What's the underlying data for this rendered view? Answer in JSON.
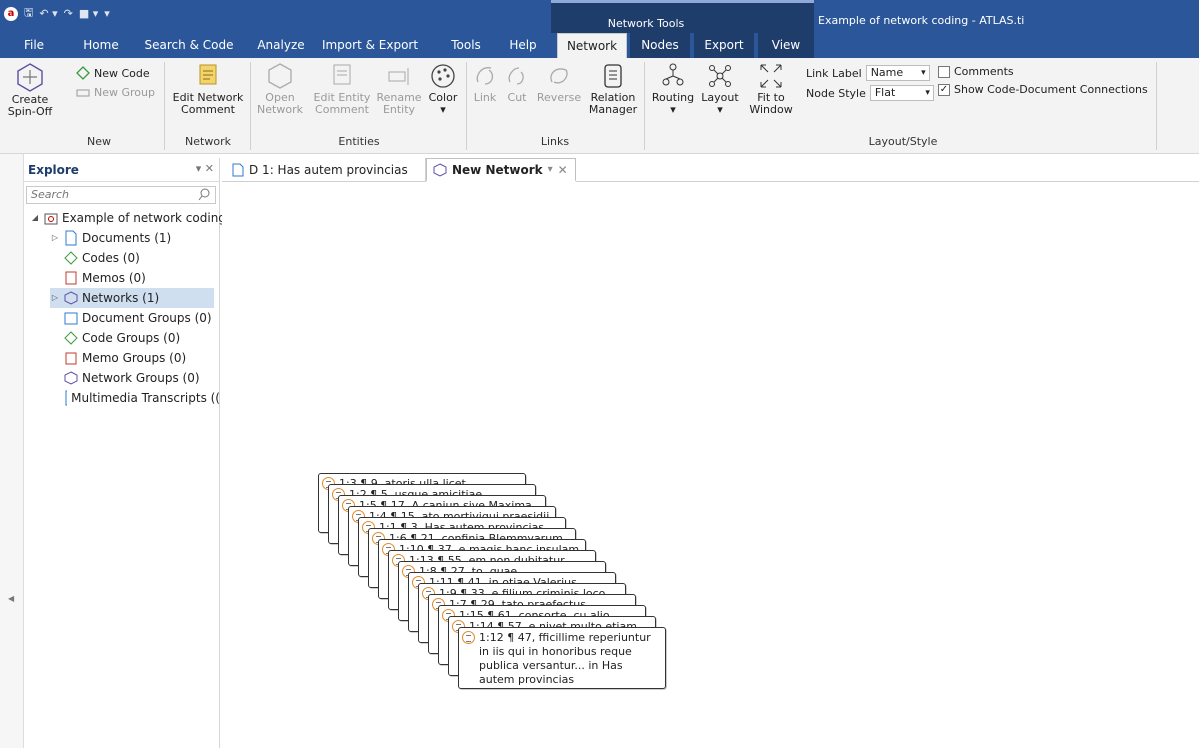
{
  "titlebar": {
    "context_group": "Network Tools",
    "window_title": "Example of network coding - ATLAS.ti"
  },
  "tabs": [
    "File",
    "Home",
    "Search & Code",
    "Analyze",
    "Import & Export",
    "Tools",
    "Help",
    "Network",
    "Nodes",
    "Export",
    "View"
  ],
  "active_tab": "Network",
  "ribbon": {
    "create_spinoff": "Create Spin-Off",
    "new_code": "New Code",
    "new_group": "New Group",
    "group_new": "New",
    "edit_network_comment": "Edit Network Comment",
    "group_network": "Network",
    "open_network": "Open Network",
    "edit_entity_comment": "Edit Entity Comment",
    "rename_entity": "Rename Entity",
    "color": "Color",
    "group_entities": "Entities",
    "link": "Link",
    "cut": "Cut",
    "reverse": "Reverse",
    "relation_manager": "Relation Manager",
    "group_links": "Links",
    "routing": "Routing",
    "layout": "Layout",
    "fit_to_window": "Fit to Window",
    "link_label_caption": "Link Label",
    "link_label_value": "Name",
    "node_style_caption": "Node Style",
    "node_style_value": "Flat",
    "comments": "Comments",
    "show_code_doc": "Show Code-Document Connections",
    "group_layout_style": "Layout/Style"
  },
  "explore": {
    "title": "Explore",
    "search_placeholder": "Search",
    "root": "Example of network coding",
    "items": [
      {
        "label": "Documents (1)"
      },
      {
        "label": "Codes (0)"
      },
      {
        "label": "Memos (0)"
      },
      {
        "label": "Networks (1)"
      },
      {
        "label": "Document Groups (0)"
      },
      {
        "label": "Code Groups (0)"
      },
      {
        "label": "Memo Groups (0)"
      },
      {
        "label": "Network Groups (0)"
      },
      {
        "label": "Multimedia Transcripts (("
      }
    ]
  },
  "doc_tabs": [
    {
      "label": "D 1: Has autem provincias"
    },
    {
      "label": "New Network"
    }
  ],
  "nodes": [
    {
      "text": "1:3 ¶ 9, atoris ulla licet subdidicii in"
    },
    {
      "text": "1:2 ¶ 5, usque amicitiae difficillime"
    },
    {
      "text": "1:5 ¶ 17, A caniun sive Maxima"
    },
    {
      "text": "1:4 ¶ 15, ato mortiviqui praesidii"
    },
    {
      "text": "1:1 ¶ 3, Has autem provincias, quas"
    },
    {
      "text": "1:6 ¶ 21, confinia Blemmyarum,"
    },
    {
      "text": "1:10 ¶ 37, e magis hanc insulam"
    },
    {
      "text": "1:13 ¶ 55, em non dubitatur quod"
    },
    {
      "text": "1:8 ¶ 27, to, quae comoberabuntur in"
    },
    {
      "text": "1:11 ¶ 41, in otiae Valerius humatur"
    },
    {
      "text": "1:9 ¶ 33, e filium criminis loco poni"
    },
    {
      "text": "1:7 ¶ 29, tato praefectus praetorio"
    },
    {
      "text": "1:15 ¶ 61, consorte, cu alio latere"
    },
    {
      "text": "1:14 ¶ 57, e nivet multo etiam"
    },
    {
      "text": "1:12 ¶ 47, fficillime reperiuntur in iis qui in honoribus reque publica versantur... in Has autem provincias"
    }
  ]
}
